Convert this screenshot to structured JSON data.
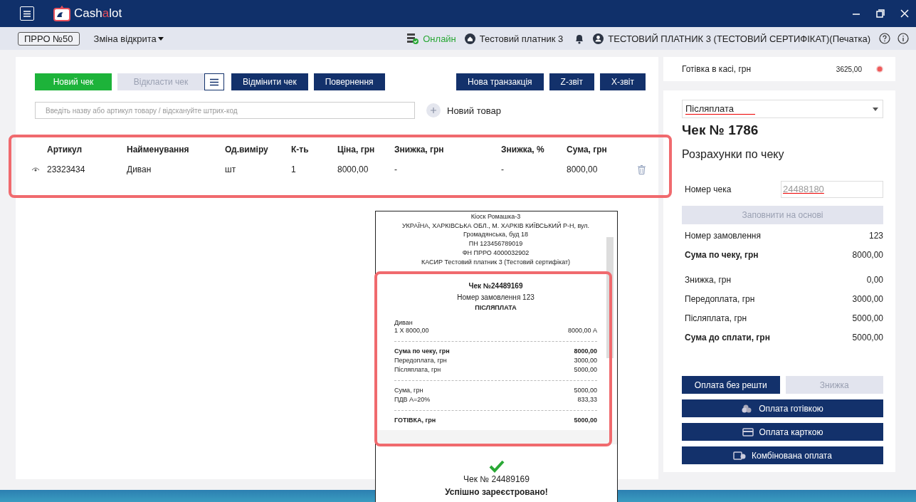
{
  "titlebar": {
    "logo": [
      "Cash",
      "a",
      "lot"
    ]
  },
  "statusbar": {
    "register": "ПРРО №50",
    "shift": "Зміна відкрита",
    "connection": "Онлайн",
    "payer": "Тестовий платник 3",
    "user": "ТЕСТОВИЙ ПЛАТНИК 3 (ТЕСТОВИЙ СЕРТИФІКАТ)(Печатка)"
  },
  "left_buttons": [
    {
      "label": "Новий чек",
      "kind": "green"
    },
    {
      "label": "Відкласти чек",
      "kind": "disabled"
    },
    {
      "kind": "menu"
    },
    {
      "label": "Відмінити чек",
      "kind": "dark"
    },
    {
      "label": "Повернення",
      "kind": "dark"
    }
  ],
  "right_buttons": [
    {
      "label": "Нова транзакція",
      "kind": "dark"
    },
    {
      "label": "Z-звіт",
      "kind": "dark"
    },
    {
      "label": "X-звіт",
      "kind": "dark"
    }
  ],
  "search": {
    "placeholder": "Введіть назву або артикул товару / відскануйте штрих-код"
  },
  "new_item": "Новий товар",
  "table": {
    "columns": [
      "Артикул",
      "Найменування",
      "Од.виміру",
      "К-ть",
      "Ціна, грн",
      "Знижка, грн",
      "Знижка, %",
      "Сума, грн"
    ],
    "rows": [
      {
        "cells": [
          "23323434",
          "Диван",
          "шт",
          "1",
          "8000,00",
          "-",
          "-",
          "8000,00"
        ]
      }
    ]
  },
  "cash": {
    "label": "Готівка в касі, грн",
    "value": "3625,00"
  },
  "payment_type": "Післяплата",
  "check_title": "Чек № 1786",
  "subtitle": "Розрахунки по чеку",
  "check_number": {
    "label": "Номер чека",
    "placeholder": "24488180"
  },
  "fill_button": {
    "label": "Заповнити на основі",
    "disabled": true
  },
  "summary": [
    {
      "label": "Номер замовлення",
      "value": "123",
      "bold": false
    },
    {
      "label": "Сума по чеку, грн",
      "value": "8000,00",
      "bold": true
    }
  ],
  "totals": [
    {
      "label": "Знижка, грн",
      "value": "0,00",
      "bold": false
    },
    {
      "label": "Передоплата, грн",
      "value": "3000,00",
      "bold": false
    },
    {
      "label": "Післяплата, грн",
      "value": "5000,00",
      "bold": false
    },
    {
      "label": "Сума до сплати, грн",
      "value": "5000,00",
      "bold": true
    }
  ],
  "pay_buttons": [
    {
      "label": "Оплата без решти",
      "kind": "dark"
    },
    {
      "label": "Знижка",
      "kind": "disabled"
    }
  ],
  "payment_methods": [
    {
      "label": "Оплата готівкою",
      "kind": "cash"
    },
    {
      "label": "Оплата карткою",
      "kind": "card"
    },
    {
      "label": "Комбінована оплата",
      "kind": "combined"
    }
  ],
  "receipt": {
    "header": [
      "Кіоск Ромашка-3",
      "УКРАЇНА, ХАРКІВСЬКА ОБЛ., М. ХАРКІВ КИЇВСЬКИЙ Р-Н, вул. Громадянська, буд 18",
      "ПН 123456789019",
      "ФН ПРРО 4000032902",
      "КАСИР Тестовий платник 3 (Тестовий сертифікат)"
    ],
    "title": "Чек №24489169",
    "order": "Номер замовлення 123",
    "type": "ПІСЛЯПЛАТА",
    "item": {
      "name": "Диван",
      "line": "1 X 8000,00",
      "sum": "8000,00 А"
    },
    "sections": [
      [
        {
          "label": "Сума по чеку, грн",
          "value": "8000,00",
          "bold": true
        },
        {
          "label": "Передоплата, грн",
          "value": "3000,00",
          "bold": false
        },
        {
          "label": "Післяплата, грн",
          "value": "5000,00",
          "bold": false
        }
      ],
      [
        {
          "label": "Сума, грн",
          "value": "5000,00",
          "bold": false
        },
        {
          "label": "ПДВ А=20%",
          "value": "833,33",
          "bold": false
        }
      ],
      [
        {
          "label": "ГОТІВКА, грн",
          "value": "5000,00",
          "bold": true
        }
      ]
    ],
    "result_number": "Чек № 24489169",
    "result_text": "Успішно зареєстровано!"
  }
}
